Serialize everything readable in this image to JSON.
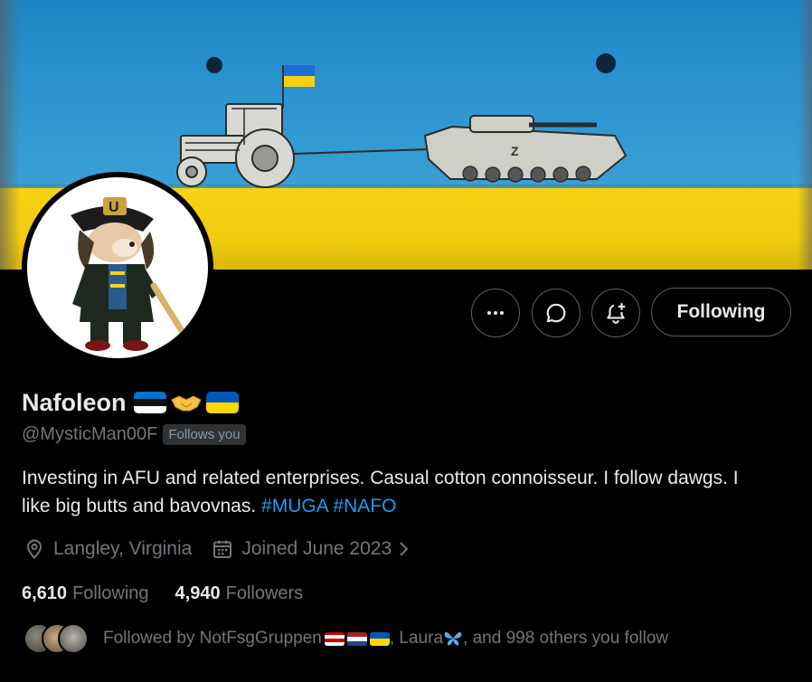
{
  "profile": {
    "display_name": "Nafoleon",
    "name_emojis": [
      "estonia-flag",
      "handshake",
      "ukraine-flag"
    ],
    "handle": "@MysticMan00F",
    "follows_you_badge": "Follows you",
    "bio_text": "Investing in AFU and related enterprises. Casual cotton connoisseur. I follow dawgs. I like big butts and bavovnas.",
    "hashtags": [
      "#MUGA",
      "#NAFO"
    ],
    "location": "Langley, Virginia",
    "joined": "Joined June 2023"
  },
  "actions": {
    "more_icon": "more-icon",
    "message_icon": "message-icon",
    "notify_icon": "notify-icon",
    "following_label": "Following"
  },
  "stats": {
    "following_count": "6,610",
    "following_label": "Following",
    "followers_count": "4,940",
    "followers_label": "Followers"
  },
  "followed_by": {
    "prefix": "Followed by",
    "first": "NotFsgGruppen",
    "first_emojis": [
      "malaysia-flag",
      "netherlands-flag",
      "ukraine-flag"
    ],
    "separator": ",",
    "second": "Laura",
    "second_emoji": "butterfly",
    "suffix": ", and 998 others you follow"
  },
  "colors": {
    "background": "#000000",
    "text_primary": "#e7e9ea",
    "text_secondary": "#71767b",
    "accent": "#1d9bf0",
    "border": "#536471",
    "ukraine_blue": "#0057b7",
    "ukraine_yellow": "#ffd700"
  }
}
